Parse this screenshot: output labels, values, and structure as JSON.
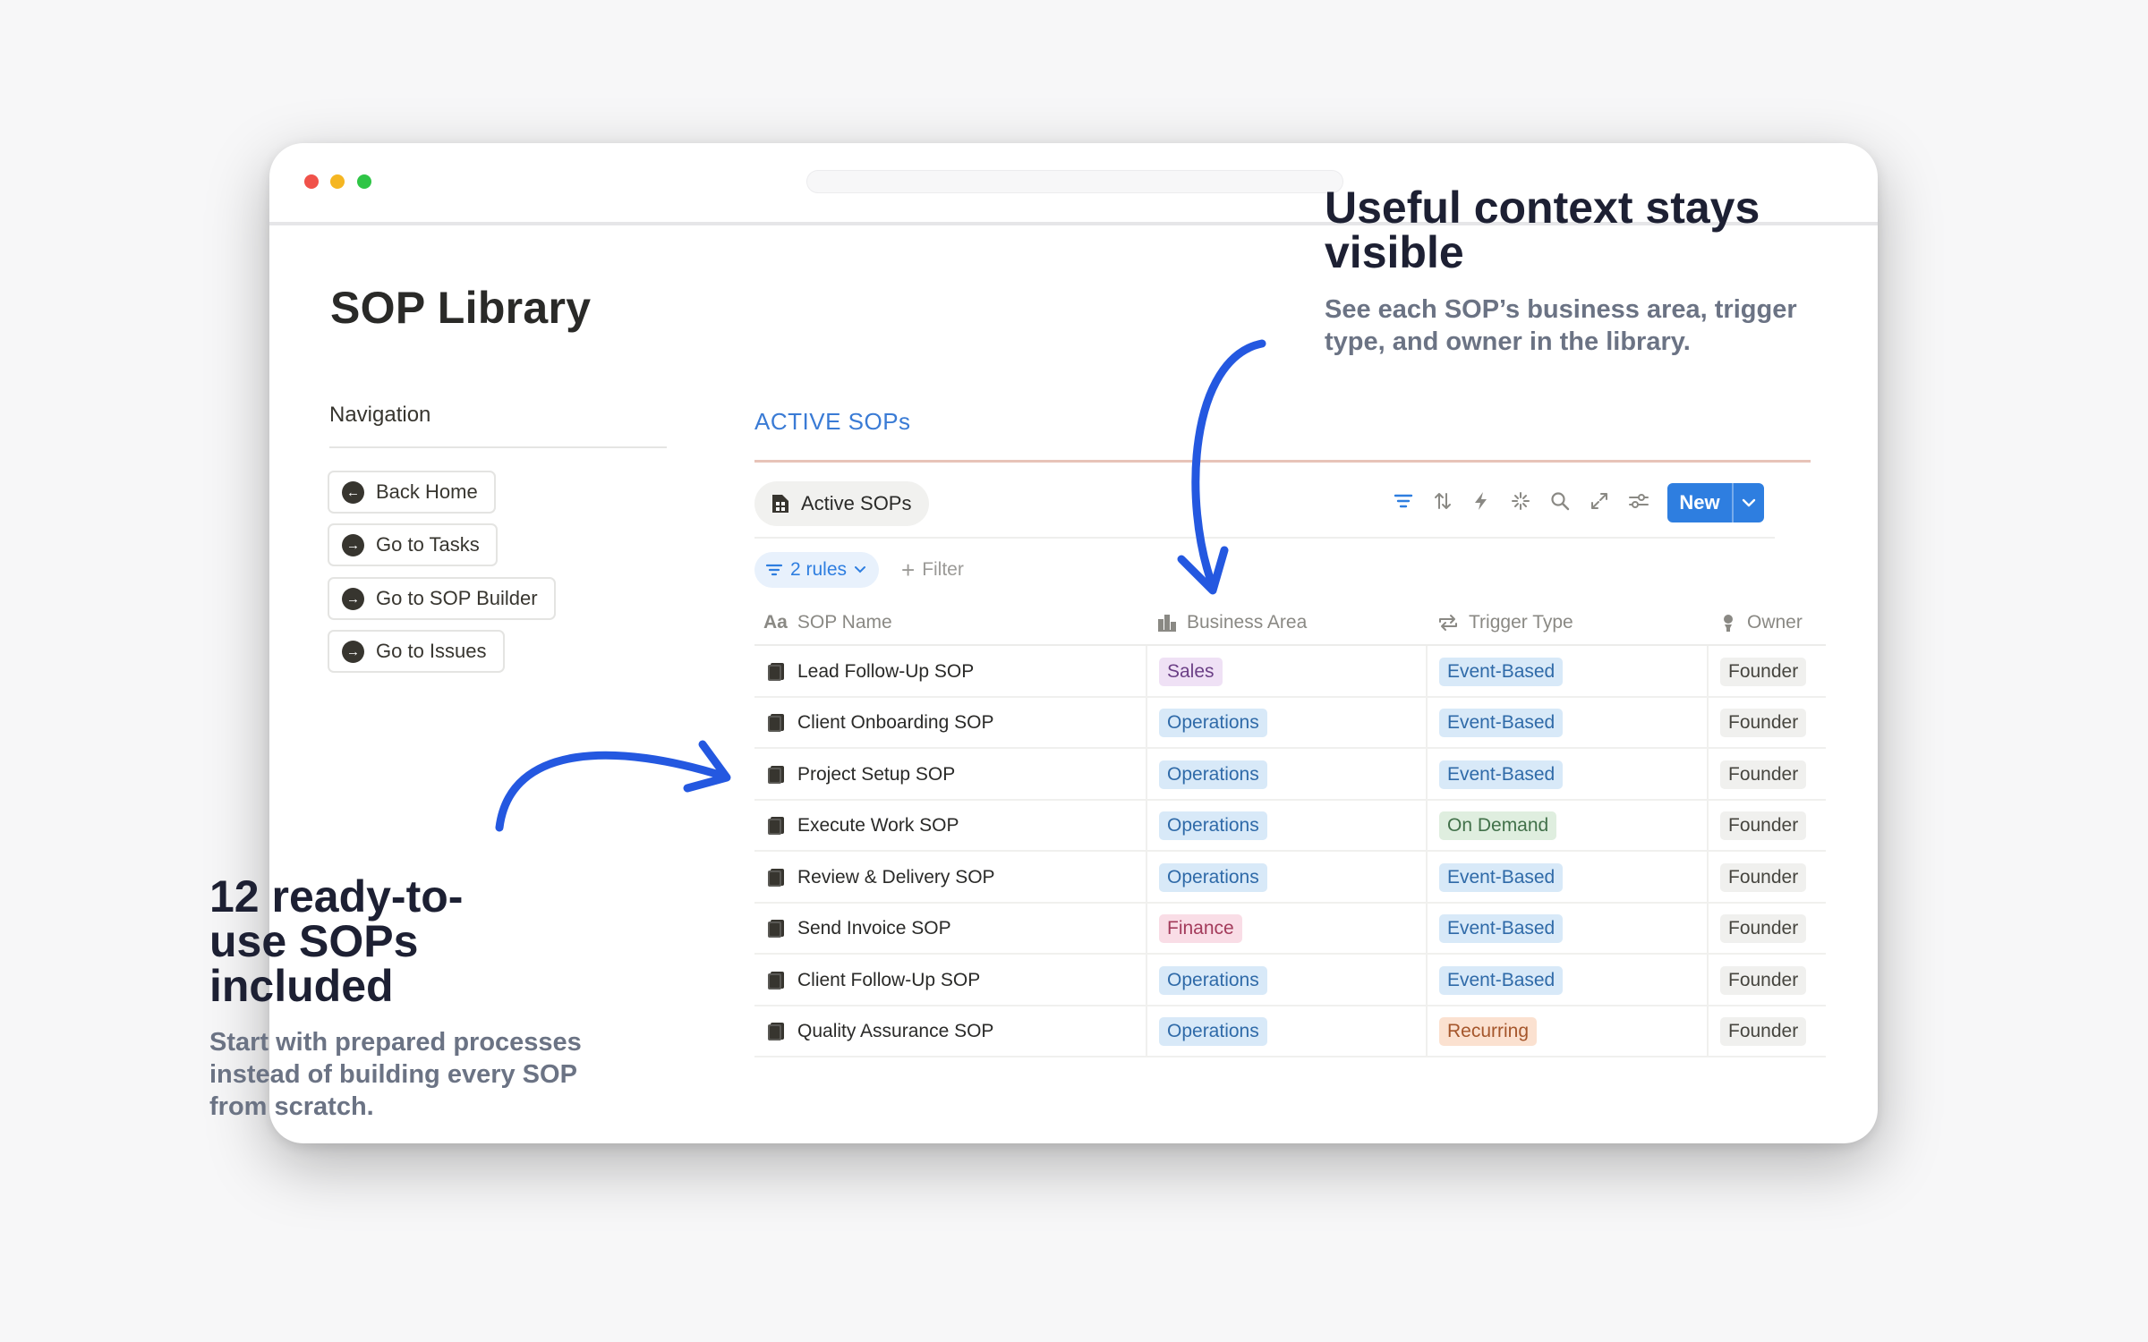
{
  "window": {
    "controls": [
      "close",
      "minimize",
      "maximize"
    ]
  },
  "page": {
    "title": "SOP Library"
  },
  "navigation": {
    "heading": "Navigation",
    "buttons": [
      {
        "label": "Back Home",
        "icon": "arrow-left-circle-icon"
      },
      {
        "label": "Go to Tasks",
        "icon": "arrow-right-circle-icon"
      },
      {
        "label": "Go to SOP Builder",
        "icon": "arrow-right-circle-icon"
      },
      {
        "label": "Go to Issues",
        "icon": "arrow-right-circle-icon"
      }
    ]
  },
  "database": {
    "section_title": "ACTIVE SOPs",
    "view_tab": "Active SOPs",
    "toolbar": {
      "icons": [
        "filter-icon",
        "sort-icon",
        "automation-icon",
        "ai-sparkle-icon",
        "search-icon",
        "expand-icon",
        "settings-icon"
      ],
      "new_label": "New"
    },
    "rules_label": "2 rules",
    "filter_label": "Filter",
    "columns": [
      {
        "label": "SOP Name",
        "icon": "text-property-icon"
      },
      {
        "label": "Business Area",
        "icon": "select-property-icon"
      },
      {
        "label": "Trigger Type",
        "icon": "repeat-property-icon"
      },
      {
        "label": "Owner",
        "icon": "person-property-icon"
      }
    ],
    "rows": [
      {
        "name": "Lead Follow-Up SOP",
        "area": "Sales",
        "trigger": "Event-Based",
        "owner": "Founder"
      },
      {
        "name": "Client Onboarding SOP",
        "area": "Operations",
        "trigger": "Event-Based",
        "owner": "Founder"
      },
      {
        "name": "Project Setup SOP",
        "area": "Operations",
        "trigger": "Event-Based",
        "owner": "Founder"
      },
      {
        "name": "Execute Work SOP",
        "area": "Operations",
        "trigger": "On Demand",
        "owner": "Founder"
      },
      {
        "name": "Review & Delivery SOP",
        "area": "Operations",
        "trigger": "Event-Based",
        "owner": "Founder"
      },
      {
        "name": "Send Invoice SOP",
        "area": "Finance",
        "trigger": "Event-Based",
        "owner": "Founder"
      },
      {
        "name": "Client Follow-Up SOP",
        "area": "Operations",
        "trigger": "Event-Based",
        "owner": "Founder"
      },
      {
        "name": "Quality Assurance SOP",
        "area": "Operations",
        "trigger": "Recurring",
        "owner": "Founder"
      }
    ],
    "tag_colors": {
      "Sales": "#efe1f5",
      "Operations": "#d8e9f8",
      "Finance": "#f9dde6",
      "Event-Based": "#d8e9f8",
      "On Demand": "#dfeedf",
      "Recurring": "#fbe1d0"
    }
  },
  "callouts": {
    "top": {
      "title": "Useful context stays visible",
      "text": "See each SOP’s business area, trigger type, and owner in the library."
    },
    "bottom": {
      "title": "12 ready-to-use SOPs included",
      "text": "Start with prepared processes instead of building every SOP from scratch."
    },
    "arrow_color": "#2458e0"
  }
}
